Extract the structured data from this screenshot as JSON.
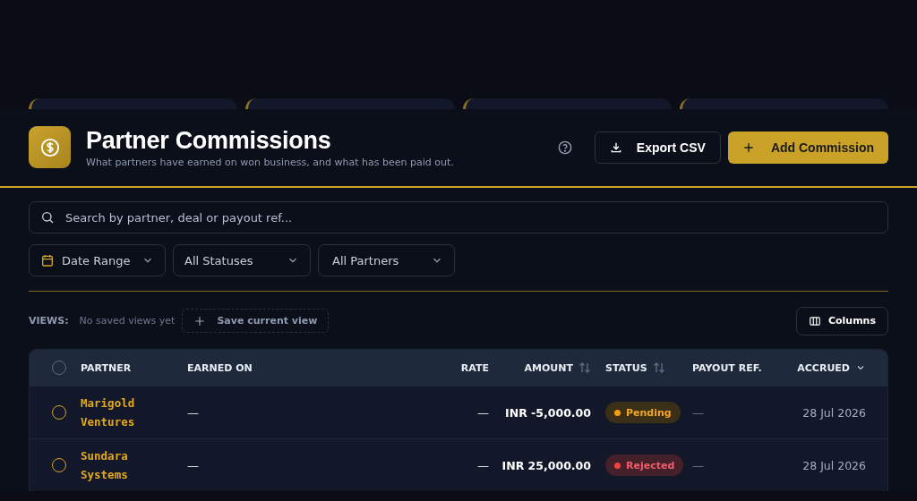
{
  "stat_cards": [
    {
      "kind": "card"
    },
    {
      "kind": "card"
    },
    {
      "kind": "card"
    },
    {
      "kind": "card"
    }
  ],
  "header": {
    "title": "Partner Commissions",
    "subtitle": "What partners have earned on won business, and what has been paid out.",
    "export_button": "Export CSV",
    "add_button": "Add Commission"
  },
  "search": {
    "placeholder": "Search by partner, deal or payout ref..."
  },
  "filters": [
    {
      "label": "Date Range",
      "kind": "date"
    },
    {
      "label": "All Statuses",
      "kind": "select"
    },
    {
      "label": "All Partners",
      "kind": "select"
    }
  ],
  "views": {
    "label": "VIEWS:",
    "empty_text": "No saved views yet",
    "save_button": "Save current view",
    "columns_button": "Columns"
  },
  "table": {
    "select_all": {
      "checked": false
    },
    "columns": [
      {
        "label": "PARTNER",
        "kind": "plain"
      },
      {
        "label": "EARNED ON",
        "kind": "plain"
      },
      {
        "label": "RATE",
        "kind": "plain"
      },
      {
        "label": "AMOUNT",
        "kind": "sortable"
      },
      {
        "label": "STATUS",
        "kind": "sortable"
      },
      {
        "label": "PAYOUT REF.",
        "kind": "plain"
      },
      {
        "label": "ACCRUED",
        "kind": "sorted"
      }
    ],
    "rows": [
      {
        "checked": false,
        "partner": "Marigold Ventures",
        "earned_on": "—",
        "rate": "—",
        "amount": "INR -5,000.00",
        "status": {
          "label": "Pending",
          "kind": "pending"
        },
        "payout_ref": "—",
        "accrued": "28 Jul 2026"
      },
      {
        "checked": false,
        "partner": "Sundara Systems",
        "earned_on": "—",
        "rate": "—",
        "amount": "INR 25,000.00",
        "status": {
          "label": "Rejected",
          "kind": "rejected"
        },
        "payout_ref": "—",
        "accrued": "28 Jul 2026"
      }
    ]
  }
}
